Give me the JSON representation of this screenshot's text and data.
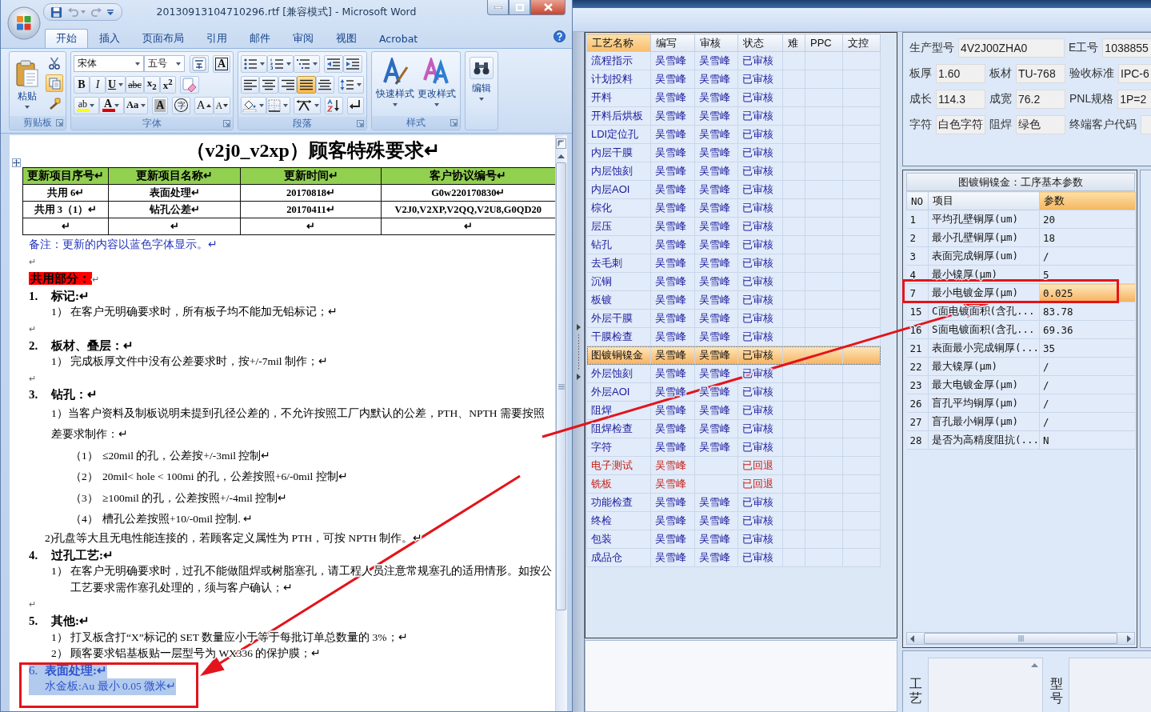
{
  "word": {
    "title": "20130913104710296.rtf [兼容模式] - Microsoft Word",
    "quick_access": [
      {
        "kind": "save",
        "disabled": false
      },
      {
        "kind": "undo",
        "disabled": true
      },
      {
        "kind": "redo",
        "disabled": true
      },
      {
        "kind": "customize",
        "disabled": false
      }
    ],
    "tabs": [
      {
        "label": "开始",
        "selected": true
      },
      {
        "label": "插入",
        "selected": false
      },
      {
        "label": "页面布局",
        "selected": false
      },
      {
        "label": "引用",
        "selected": false
      },
      {
        "label": "邮件",
        "selected": false
      },
      {
        "label": "审阅",
        "selected": false
      },
      {
        "label": "视图",
        "selected": false
      },
      {
        "label": "Acrobat",
        "selected": false
      }
    ],
    "ribbon": [
      {
        "kind": "clipboard",
        "label": "剪贴板",
        "paste": "粘贴",
        "tools": [
          {
            "kind": "cut",
            "active": false
          },
          {
            "kind": "copy",
            "active": true
          },
          {
            "kind": "format_painter",
            "active": false
          }
        ]
      },
      {
        "kind": "font",
        "label": "字体",
        "font_name": "宋体",
        "font_size": "五号",
        "buttons": [
          [
            {
              "kind": "phonetic"
            },
            {
              "kind": "char_border",
              "label": "A"
            }
          ],
          [
            {
              "kind": "bold",
              "label": "B"
            },
            {
              "kind": "italic",
              "label": "I"
            },
            {
              "kind": "underline",
              "label": "U"
            },
            {
              "kind": "strike",
              "label": "abc"
            },
            {
              "kind": "subscript",
              "label": "x$_{2}$"
            },
            {
              "kind": "superscript",
              "label": "x$^{2}$"
            },
            {
              "kind": "clear"
            }
          ],
          [
            {
              "kind": "highlight",
              "label": "ab"
            },
            {
              "kind": "font_color",
              "label": "A"
            },
            {
              "kind": "change_case",
              "label": "Aa"
            },
            {
              "kind": "shading",
              "label": "A"
            },
            {
              "kind": "enclose",
              "label": "字"
            },
            {
              "kind": "grow",
              "label": "A"
            },
            {
              "kind": "shrink",
              "label": "A"
            }
          ]
        ]
      },
      {
        "kind": "paragraph",
        "label": "段落",
        "alignment": [
          {
            "kind": "left",
            "selected": false
          },
          {
            "kind": "center",
            "selected": false
          },
          {
            "kind": "right",
            "selected": false
          },
          {
            "kind": "justify",
            "selected": true
          },
          {
            "kind": "distribute",
            "selected": false
          }
        ]
      },
      {
        "kind": "styles",
        "label": "样式",
        "buttons": [
          {
            "kind": "quick",
            "label": "快速样式"
          },
          {
            "kind": "change",
            "label": "更改样式"
          }
        ]
      },
      {
        "kind": "editing",
        "label": "编辑"
      }
    ],
    "document": {
      "title": "（v2j0_v2xp）顾客特殊要求↵",
      "table": {
        "columns": [
          "更新项目序号↵",
          "更新项目名称↵",
          "更新时间↵",
          "客户协议编号↵"
        ],
        "rows": [
          [
            "共用 6↵",
            "表面处理↵",
            "20170818↵",
            "G0w220170830↵"
          ],
          [
            "共用 3（1）↵",
            "钻孔公差↵",
            "20170411↵",
            "V2J0,V2XP,V2QQ,V2U8,G0QD20"
          ],
          [
            "↵",
            "↵",
            "↵",
            "↵"
          ]
        ]
      },
      "paragraphs": [
        {
          "kind": "plain",
          "text": "备注：更新的内容以蓝色字体显示。↵",
          "color": "#2233bb",
          "selected": false
        },
        {
          "kind": "blank",
          "text": "↵",
          "selected": false
        },
        {
          "kind": "label",
          "text": "共用部分：",
          "end": "↵",
          "selected": false
        },
        {
          "kind": "heading",
          "number": "1.",
          "text": "标记:↵",
          "color": "#000000",
          "selected": false
        },
        {
          "kind": "item",
          "number": "1）",
          "text": "在客户无明确要求时，所有板子均不能加无铅标记；↵",
          "color": "#000000",
          "selected": false
        },
        {
          "kind": "blank",
          "text": "↵",
          "selected": false
        },
        {
          "kind": "heading",
          "number": "2.",
          "text": "板材、叠层：↵",
          "color": "#000000",
          "selected": false
        },
        {
          "kind": "item",
          "number": "1）",
          "text": "完成板厚文件中没有公差要求时，按+/-7mil 制作；↵",
          "color": "#000000",
          "selected": false
        },
        {
          "kind": "blank",
          "text": "↵",
          "selected": false
        },
        {
          "kind": "heading",
          "number": "3.",
          "text": "钻孔：↵",
          "color": "#000000",
          "selected": false
        },
        {
          "kind": "loose",
          "text": "1）当客户资料及制板说明未提到孔径公差的，不允许按照工厂内默认的公差，PTH、NPTH 需要按照",
          "color": "#000000",
          "selected": false
        },
        {
          "kind": "loose",
          "text": "差要求制作：↵",
          "color": "#000000",
          "selected": false
        },
        {
          "kind": "subitem",
          "number": "（1）",
          "text": "≤20mil 的孔，公差按+/-3mil 控制↵",
          "color": "#000000",
          "selected": false
        },
        {
          "kind": "subitem",
          "number": "（2）",
          "text": "20mil< hole < 100mi 的孔，公差按照+6/-0mil 控制↵",
          "color": "#000000",
          "selected": false
        },
        {
          "kind": "subitem",
          "number": "（3）",
          "text": "≥100mil 的孔，公差按照+/-4mil 控制↵",
          "color": "#000000",
          "selected": false
        },
        {
          "kind": "subitem",
          "number": "（4）",
          "text": "槽孔公差按照+10/-0mil 控制. ↵",
          "color": "#000000",
          "selected": false
        },
        {
          "kind": "aside",
          "text": "2)孔盘等大且无电性能连接的，若顾客定义属性为 PTH，可按 NPTH 制作。↵",
          "color": "#000000",
          "selected": false
        },
        {
          "kind": "heading",
          "number": "4.",
          "text": "过孔工艺:↵",
          "color": "#000000",
          "selected": false
        },
        {
          "kind": "item",
          "number": "1）",
          "text": "在客户无明确要求时，过孔不能做阻焊或树脂塞孔，请工程人员注意常规塞孔的适用情形。如按公",
          "color": "#000000",
          "selected": false
        },
        {
          "kind": "continuation",
          "text": "工艺要求需作塞孔处理的，须与客户确认；↵",
          "color": "#000000",
          "selected": false
        },
        {
          "kind": "blank",
          "text": "↵",
          "selected": false
        },
        {
          "kind": "heading",
          "number": "5.",
          "text": "其他:↵",
          "color": "#000000",
          "selected": false
        },
        {
          "kind": "item",
          "number": "1）",
          "text": "打叉板含打“X”标记的 SET 数量应小于等于每批订单总数量的 3%；↵",
          "color": "#000000",
          "selected": false
        },
        {
          "kind": "item",
          "number": "2）",
          "text": "顾客要求铝基板贴一层型号为 WX336 的保护膜；↵",
          "color": "#000000",
          "selected": false
        },
        {
          "kind": "numbered",
          "number": "6.",
          "text": "表面处理:↵",
          "color": "#2e55cc",
          "selected": true
        },
        {
          "kind": "aside",
          "text": "水金板:Au 最小 0.05 微米↵",
          "color": "#2e55cc",
          "selected": true
        }
      ]
    }
  },
  "process_table": {
    "columns": [
      {
        "label": "工艺名称",
        "selected": true
      },
      {
        "label": "编写",
        "selected": false
      },
      {
        "label": "审核",
        "selected": false
      },
      {
        "label": "状态",
        "selected": false
      },
      {
        "label": "难",
        "selected": false
      },
      {
        "label": "PPC",
        "selected": false
      },
      {
        "label": "文控",
        "selected": false
      }
    ],
    "rows": [
      {
        "name": "流程指示",
        "writer": "吴雪峰",
        "reviewer": "吴雪峰",
        "status": "已审核",
        "returned": false,
        "selected": false
      },
      {
        "name": "计划投料",
        "writer": "吴雪峰",
        "reviewer": "吴雪峰",
        "status": "已审核",
        "returned": false,
        "selected": false
      },
      {
        "name": "开料",
        "writer": "吴雪峰",
        "reviewer": "吴雪峰",
        "status": "已审核",
        "returned": false,
        "selected": false
      },
      {
        "name": "开料后烘板",
        "writer": "吴雪峰",
        "reviewer": "吴雪峰",
        "status": "已审核",
        "returned": false,
        "selected": false
      },
      {
        "name": "LDI定位孔",
        "writer": "吴雪峰",
        "reviewer": "吴雪峰",
        "status": "已审核",
        "returned": false,
        "selected": false
      },
      {
        "name": "内层干膜",
        "writer": "吴雪峰",
        "reviewer": "吴雪峰",
        "status": "已审核",
        "returned": false,
        "selected": false
      },
      {
        "name": "内层蚀刻",
        "writer": "吴雪峰",
        "reviewer": "吴雪峰",
        "status": "已审核",
        "returned": false,
        "selected": false
      },
      {
        "name": "内层AOI",
        "writer": "吴雪峰",
        "reviewer": "吴雪峰",
        "status": "已审核",
        "returned": false,
        "selected": false
      },
      {
        "name": "棕化",
        "writer": "吴雪峰",
        "reviewer": "吴雪峰",
        "status": "已审核",
        "returned": false,
        "selected": false
      },
      {
        "name": "层压",
        "writer": "吴雪峰",
        "reviewer": "吴雪峰",
        "status": "已审核",
        "returned": false,
        "selected": false
      },
      {
        "name": "钻孔",
        "writer": "吴雪峰",
        "reviewer": "吴雪峰",
        "status": "已审核",
        "returned": false,
        "selected": false
      },
      {
        "name": "去毛刺",
        "writer": "吴雪峰",
        "reviewer": "吴雪峰",
        "status": "已审核",
        "returned": false,
        "selected": false
      },
      {
        "name": "沉铜",
        "writer": "吴雪峰",
        "reviewer": "吴雪峰",
        "status": "已审核",
        "returned": false,
        "selected": false
      },
      {
        "name": "板镀",
        "writer": "吴雪峰",
        "reviewer": "吴雪峰",
        "status": "已审核",
        "returned": false,
        "selected": false
      },
      {
        "name": "外层干膜",
        "writer": "吴雪峰",
        "reviewer": "吴雪峰",
        "status": "已审核",
        "returned": false,
        "selected": false
      },
      {
        "name": "干膜检查",
        "writer": "吴雪峰",
        "reviewer": "吴雪峰",
        "status": "已审核",
        "returned": false,
        "selected": false
      },
      {
        "name": "图镀铜镍金",
        "writer": "吴雪峰",
        "reviewer": "吴雪峰",
        "status": "已审核",
        "returned": false,
        "selected": true
      },
      {
        "name": "外层蚀刻",
        "writer": "吴雪峰",
        "reviewer": "吴雪峰",
        "status": "已审核",
        "returned": false,
        "selected": false
      },
      {
        "name": "外层AOI",
        "writer": "吴雪峰",
        "reviewer": "吴雪峰",
        "status": "已审核",
        "returned": false,
        "selected": false
      },
      {
        "name": "阻焊",
        "writer": "吴雪峰",
        "reviewer": "吴雪峰",
        "status": "已审核",
        "returned": false,
        "selected": false
      },
      {
        "name": "阻焊检查",
        "writer": "吴雪峰",
        "reviewer": "吴雪峰",
        "status": "已审核",
        "returned": false,
        "selected": false
      },
      {
        "name": "字符",
        "writer": "吴雪峰",
        "reviewer": "吴雪峰",
        "status": "已审核",
        "returned": false,
        "selected": false
      },
      {
        "name": "电子测试",
        "writer": "吴雪峰",
        "status": "已回退",
        "returned": true,
        "selected": false
      },
      {
        "name": "铣板",
        "writer": "吴雪峰",
        "status": "已回退",
        "returned": true,
        "selected": false
      },
      {
        "name": "功能检查",
        "writer": "吴雪峰",
        "reviewer": "吴雪峰",
        "status": "已审核",
        "returned": false,
        "selected": false
      },
      {
        "name": "终检",
        "writer": "吴雪峰",
        "reviewer": "吴雪峰",
        "status": "已审核",
        "returned": false,
        "selected": false
      },
      {
        "name": "包装",
        "writer": "吴雪峰",
        "reviewer": "吴雪峰",
        "status": "已审核",
        "returned": false,
        "selected": false
      },
      {
        "name": "成品仓",
        "writer": "吴雪峰",
        "reviewer": "吴雪峰",
        "status": "已审核",
        "returned": false,
        "selected": false
      }
    ]
  },
  "job_form": {
    "fields": [
      {
        "label": "生产型号",
        "value": "4V2J00ZHA0"
      },
      {
        "label": "E工号",
        "value": "1038855"
      },
      {
        "label": "板厚",
        "value": "1.60"
      },
      {
        "label": "板材",
        "value": "TU-768"
      },
      {
        "label": "验收标准",
        "value": "IPC-6"
      },
      {
        "label": "成长",
        "value": "114.3"
      },
      {
        "label": "成宽",
        "value": "76.2"
      },
      {
        "label": "PNL规格",
        "value": "1P=2"
      },
      {
        "label": "字符",
        "value": "白色字符"
      },
      {
        "label": "阻焊",
        "value": "绿色"
      },
      {
        "label": "终端客户代码"
      }
    ]
  },
  "param_table": {
    "title": "图镀铜镍金：工序基本参数",
    "columns": [
      {
        "label": "NO",
        "selected": false
      },
      {
        "label": "项目",
        "selected": false
      },
      {
        "label": "参数",
        "selected": true
      }
    ],
    "rows": [
      {
        "no": "1",
        "item": "平均孔壁铜厚(um)",
        "value": "20",
        "selected": false
      },
      {
        "no": "2",
        "item": "最小孔壁铜厚(μm)",
        "value": "18",
        "selected": false
      },
      {
        "no": "3",
        "item": "表面完成铜厚(um)",
        "value": "/",
        "selected": false
      },
      {
        "no": "4",
        "item": "最小镍厚(μm)",
        "value": "5",
        "selected": false
      },
      {
        "no": "7",
        "item": "最小电镀金厚(μm)",
        "value": "0.025",
        "selected": true
      },
      {
        "no": "15",
        "item": "C面电镀面积(含孔...",
        "value": "83.78",
        "selected": false
      },
      {
        "no": "16",
        "item": "S面电镀面积(含孔...",
        "value": "69.36",
        "selected": false
      },
      {
        "no": "21",
        "item": "表面最小完成铜厚(...",
        "value": "35",
        "selected": false
      },
      {
        "no": "22",
        "item": "最大镍厚(μm)",
        "value": "/",
        "selected": false
      },
      {
        "no": "23",
        "item": "最大电镀金厚(μm)",
        "value": "/",
        "selected": false
      },
      {
        "no": "26",
        "item": "盲孔平均铜厚(μm)",
        "value": "/",
        "selected": false
      },
      {
        "no": "27",
        "item": "盲孔最小铜厚(μm)",
        "value": "/",
        "selected": false
      },
      {
        "no": "28",
        "item": "是否为高精度阻抗(...",
        "value": "N",
        "selected": false
      }
    ]
  },
  "bottom_panel": {
    "fields": [
      {
        "label": "工艺"
      },
      {
        "label": "型号"
      }
    ]
  }
}
